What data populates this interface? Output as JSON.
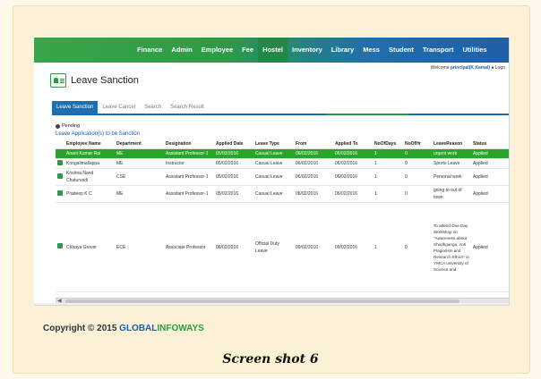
{
  "nav": {
    "items": [
      "Finance",
      "Admin",
      "Employee",
      "Fee",
      "Hostel",
      "Inventory",
      "Library",
      "Mess",
      "Student",
      "Transport",
      "Utilities"
    ],
    "active": "Hostel"
  },
  "welcome_prefix": "Welcome",
  "welcome_user": "principal(K Kamal)",
  "logout": "Logo",
  "page_title": "Leave Sanction",
  "tabs": [
    "Leave Sanction",
    "Leave Cancel",
    "Search",
    "Search Result"
  ],
  "pending_label": "Pending",
  "apps_label": "Leave Application(s) to be Sanction",
  "table": {
    "headers": [
      "Employee Name",
      "Department",
      "Designation",
      "Applied Date",
      "Leave Type",
      "From",
      "Applied To",
      "NoOfDays",
      "NoOfHr",
      "LeaveReason",
      "Status"
    ],
    "rows": [
      [
        "Anant Kumar Rai",
        "ME",
        "Assistant Professor-1",
        "05/02/2016",
        "Casual Leave",
        "06/02/2016",
        "06/02/2016",
        "1",
        "0",
        "urgent work",
        "Applied"
      ],
      [
        "Kongalimallappa",
        "ME",
        "Instructor",
        "05/02/2016",
        "Casual Leave",
        "06/02/2016",
        "06/02/2016",
        "1",
        "0",
        "Sports Leave",
        "Applied"
      ],
      [
        "Krishna Nand Chaturvedi",
        "CSE",
        "Assistant Professor-1",
        "05/02/2016",
        "Casual Leave",
        "06/02/2016",
        "06/02/2016",
        "1",
        "0",
        "Personal work",
        "Applied"
      ],
      [
        "Pradeep K C",
        "ME",
        "Assistant Professor-1",
        "05/02/2016",
        "Casual Leave",
        "06/02/2016",
        "06/02/2016",
        "1",
        "0",
        "going to out of town",
        "Applied"
      ],
      [
        "Chhaya Grover",
        "ECE",
        "Associate Professor",
        "08/02/2016",
        "Official Duty Leave",
        "09/02/2016",
        "09/02/2016",
        "1",
        "0",
        "To attend One Day Workshop on \"Awareness about Shodhganga, Anti Plagiarism and Research Ethics\" in YMCA university of Science and",
        "Applied"
      ]
    ]
  },
  "copyright": {
    "prefix": "Copyright © 2015 ",
    "brand1": "GLOBAL",
    "brand2": "INFOWAYS"
  },
  "caption": "Screen shot 6",
  "colors": {
    "nav_green": "#2e9a46",
    "nav_blue": "#1f5fa6",
    "selected_row": "#2aa52a"
  }
}
